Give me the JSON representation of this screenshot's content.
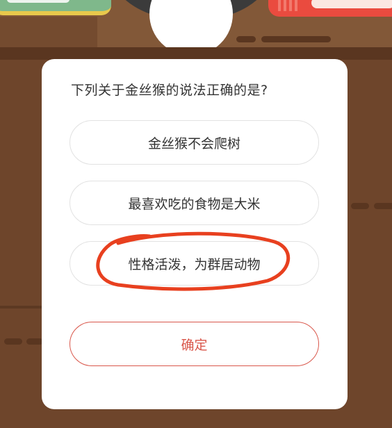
{
  "quiz": {
    "question": "下列关于金丝猴的说法正确的是?",
    "options": [
      {
        "label": "金丝猴不会爬树"
      },
      {
        "label": "最喜欢吃的食物是大米"
      },
      {
        "label": "性格活泼，为群居动物"
      }
    ],
    "confirm_label": "确定"
  },
  "colors": {
    "background": "#6e452b",
    "accent": "#d9574b",
    "annotation": "#e8401f"
  }
}
